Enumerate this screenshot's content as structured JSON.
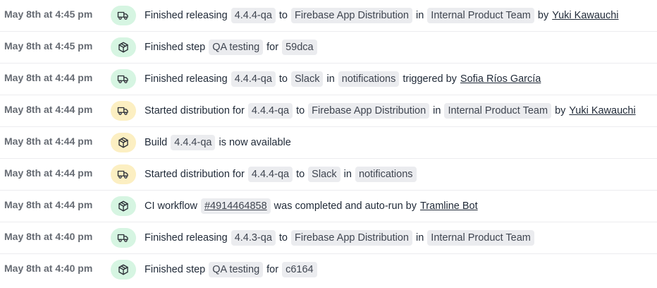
{
  "colors": {
    "success_bg": "#d6f5e2",
    "pending_bg": "#fcefc2",
    "pill_bg": "#ebecef"
  },
  "events": [
    {
      "time": "May 8th at 4:45 pm",
      "icon": "truck-icon",
      "status": "success",
      "parts": [
        {
          "t": "text",
          "v": "Finished releasing"
        },
        {
          "t": "pill",
          "v": "4.4.4-qa"
        },
        {
          "t": "text",
          "v": "to"
        },
        {
          "t": "pill",
          "v": "Firebase App Distribution"
        },
        {
          "t": "text",
          "v": "in"
        },
        {
          "t": "pill",
          "v": "Internal Product Team"
        },
        {
          "t": "text",
          "v": "by"
        },
        {
          "t": "link",
          "v": "Yuki Kawauchi"
        }
      ]
    },
    {
      "time": "May 8th at 4:45 pm",
      "icon": "cube-icon",
      "status": "success",
      "parts": [
        {
          "t": "text",
          "v": "Finished step"
        },
        {
          "t": "pill",
          "v": "QA testing"
        },
        {
          "t": "text",
          "v": "for"
        },
        {
          "t": "pill",
          "v": "59dca"
        }
      ]
    },
    {
      "time": "May 8th at 4:44 pm",
      "icon": "truck-icon",
      "status": "success",
      "parts": [
        {
          "t": "text",
          "v": "Finished releasing"
        },
        {
          "t": "pill",
          "v": "4.4.4-qa"
        },
        {
          "t": "text",
          "v": "to"
        },
        {
          "t": "pill",
          "v": "Slack"
        },
        {
          "t": "text",
          "v": "in"
        },
        {
          "t": "pill",
          "v": "notifications"
        },
        {
          "t": "text",
          "v": "triggered by"
        },
        {
          "t": "link",
          "v": "Sofia Ríos García"
        }
      ]
    },
    {
      "time": "May 8th at 4:44 pm",
      "icon": "truck-icon",
      "status": "pending",
      "parts": [
        {
          "t": "text",
          "v": "Started distribution for"
        },
        {
          "t": "pill",
          "v": "4.4.4-qa"
        },
        {
          "t": "text",
          "v": "to"
        },
        {
          "t": "pill",
          "v": "Firebase App Distribution"
        },
        {
          "t": "text",
          "v": "in"
        },
        {
          "t": "pill",
          "v": "Internal Product Team"
        },
        {
          "t": "text",
          "v": "by"
        },
        {
          "t": "link",
          "v": "Yuki Kawauchi"
        }
      ]
    },
    {
      "time": "May 8th at 4:44 pm",
      "icon": "cube-icon",
      "status": "pending",
      "parts": [
        {
          "t": "text",
          "v": "Build"
        },
        {
          "t": "pill",
          "v": "4.4.4-qa"
        },
        {
          "t": "text",
          "v": "is now available"
        }
      ]
    },
    {
      "time": "May 8th at 4:44 pm",
      "icon": "truck-icon",
      "status": "pending",
      "parts": [
        {
          "t": "text",
          "v": "Started distribution for"
        },
        {
          "t": "pill",
          "v": "4.4.4-qa"
        },
        {
          "t": "text",
          "v": "to"
        },
        {
          "t": "pill",
          "v": "Slack"
        },
        {
          "t": "text",
          "v": "in"
        },
        {
          "t": "pill",
          "v": "notifications"
        }
      ]
    },
    {
      "time": "May 8th at 4:44 pm",
      "icon": "cube-icon",
      "status": "success",
      "parts": [
        {
          "t": "text",
          "v": "CI workflow"
        },
        {
          "t": "linkpill",
          "v": "#4914464858"
        },
        {
          "t": "text",
          "v": "was completed and auto-run by"
        },
        {
          "t": "link",
          "v": "Tramline Bot"
        }
      ]
    },
    {
      "time": "May 8th at 4:40 pm",
      "icon": "truck-icon",
      "status": "success",
      "parts": [
        {
          "t": "text",
          "v": "Finished releasing"
        },
        {
          "t": "pill",
          "v": "4.4.3-qa"
        },
        {
          "t": "text",
          "v": "to"
        },
        {
          "t": "pill",
          "v": "Firebase App Distribution"
        },
        {
          "t": "text",
          "v": "in"
        },
        {
          "t": "pill",
          "v": "Internal Product Team"
        }
      ]
    },
    {
      "time": "May 8th at 4:40 pm",
      "icon": "cube-icon",
      "status": "success",
      "parts": [
        {
          "t": "text",
          "v": "Finished step"
        },
        {
          "t": "pill",
          "v": "QA testing"
        },
        {
          "t": "text",
          "v": "for"
        },
        {
          "t": "pill",
          "v": "c6164"
        }
      ]
    }
  ]
}
